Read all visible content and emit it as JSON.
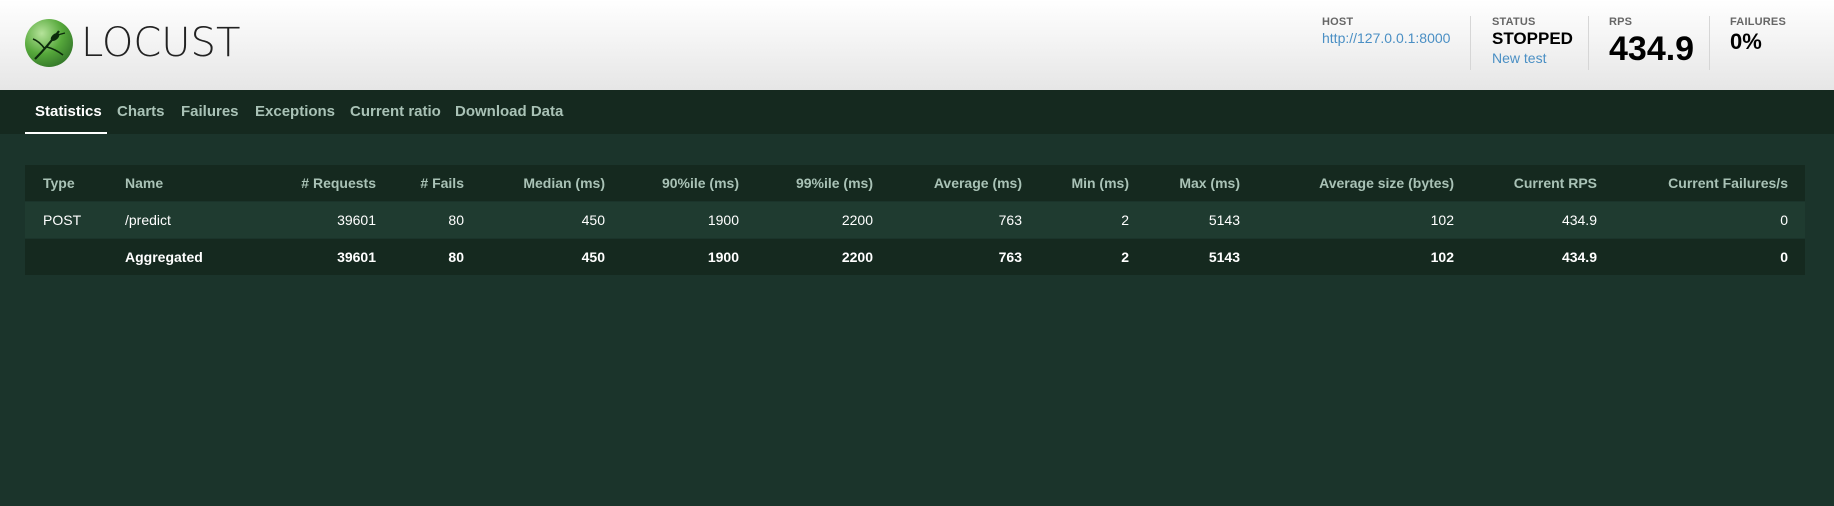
{
  "header": {
    "logo_text": "LOCUST",
    "host": {
      "label": "HOST",
      "url": "http://127.0.0.1:8000"
    },
    "status": {
      "label": "STATUS",
      "value": "STOPPED",
      "new_test_label": "New test"
    },
    "rps": {
      "label": "RPS",
      "value": "434.9"
    },
    "failures": {
      "label": "FAILURES",
      "value": "0%"
    }
  },
  "tabs": [
    {
      "label": "Statistics",
      "active": true
    },
    {
      "label": "Charts",
      "active": false
    },
    {
      "label": "Failures",
      "active": false
    },
    {
      "label": "Exceptions",
      "active": false
    },
    {
      "label": "Current ratio",
      "active": false
    },
    {
      "label": "Download Data",
      "active": false
    }
  ],
  "stats_table": {
    "columns": [
      "Type",
      "Name",
      "# Requests",
      "# Fails",
      "Median (ms)",
      "90%ile (ms)",
      "99%ile (ms)",
      "Average (ms)",
      "Min (ms)",
      "Max (ms)",
      "Average size (bytes)",
      "Current RPS",
      "Current Failures/s"
    ],
    "rows": [
      [
        "POST",
        "/predict",
        "39601",
        "80",
        "450",
        "1900",
        "2200",
        "763",
        "2",
        "5143",
        "102",
        "434.9",
        "0"
      ]
    ],
    "aggregated": [
      "",
      "Aggregated",
      "39601",
      "80",
      "450",
      "1900",
      "2200",
      "763",
      "2",
      "5143",
      "102",
      "434.9",
      "0"
    ]
  },
  "colors": {
    "page_bg": "#1b342b",
    "nav_bg": "#15291f",
    "link": "#4a8fc4",
    "header_text": "#a9c2b6"
  }
}
